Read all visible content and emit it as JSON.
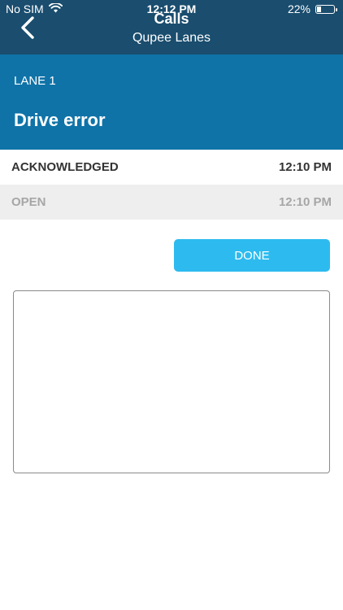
{
  "status_bar": {
    "carrier": "No SIM",
    "time": "12:12 PM",
    "battery": "22%",
    "battery_level": 0.22,
    "signal_icon": "wifi-icon"
  },
  "nav": {
    "title": "Calls",
    "subtitle": "Qupee Lanes",
    "back_icon": "chevron-left-icon"
  },
  "lane": {
    "label": "LANE 1",
    "title": "Drive error"
  },
  "status_rows": [
    {
      "status": "ACKNOWLEDGED",
      "time": "12:10 PM"
    },
    {
      "status": "OPEN",
      "time": "12:10 PM"
    }
  ],
  "actions": {
    "done_label": "DONE"
  },
  "notes": {
    "value": "",
    "placeholder": ""
  },
  "colors": {
    "nav_bg": "#1a4d6e",
    "header_bg": "#0f73a8",
    "accent": "#2dbbef"
  }
}
